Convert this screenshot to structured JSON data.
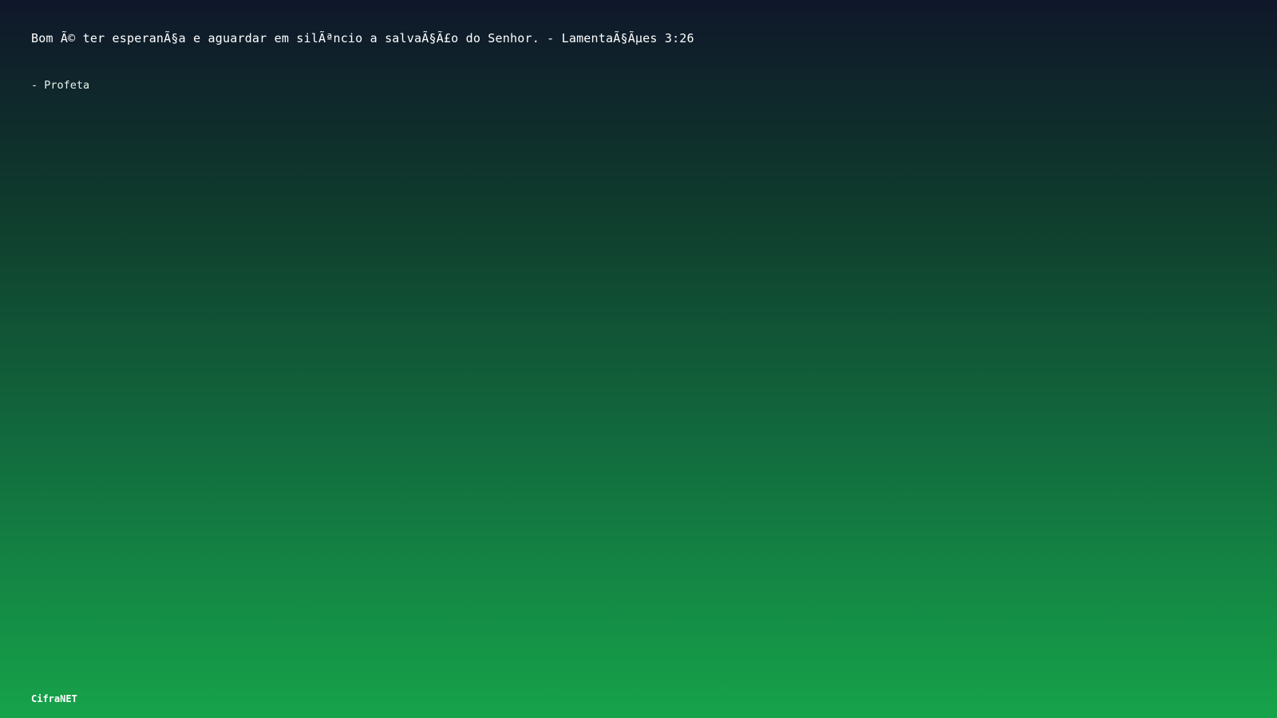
{
  "quote": {
    "text": "Bom Ã© ter esperanÃ§a e aguardar em silÃªncio a salvaÃ§Ã£o do Senhor. - LamentaÃ§Ãµes 3:26",
    "author": "- Profeta"
  },
  "brand": {
    "name": "CifraNET"
  },
  "colors": {
    "gradient_top": "#0f172a",
    "gradient_bottom": "#16a34a",
    "text": "#ffffff"
  }
}
